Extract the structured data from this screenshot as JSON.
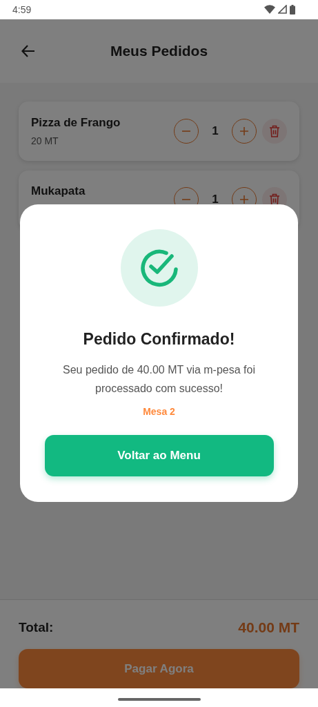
{
  "status_bar": {
    "time": "4:59"
  },
  "header": {
    "title": "Meus Pedidos"
  },
  "items": [
    {
      "name": "Pizza de Frango",
      "price": "20 MT",
      "quantity": "1"
    },
    {
      "name": "Mukapata",
      "quantity": "1"
    }
  ],
  "footer": {
    "total_label": "Total:",
    "total": "40.00 MT",
    "pay_button": "Pagar Agora"
  },
  "dialog": {
    "title": "Pedido Confirmado!",
    "message": "Seu pedido de 40.00 MT via m-pesa foi processado com sucesso!",
    "table": "Mesa 2",
    "button": "Voltar ao Menu"
  }
}
